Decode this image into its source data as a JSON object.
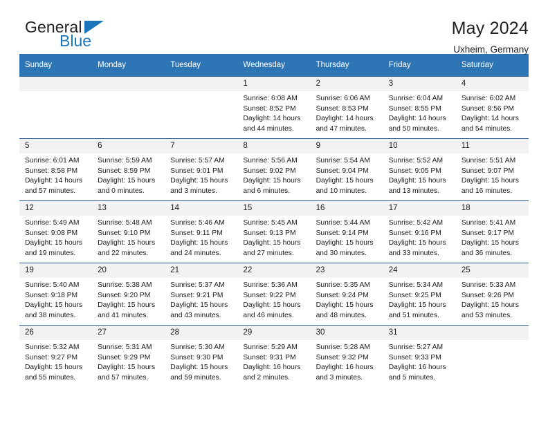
{
  "brand": {
    "name_top": "General",
    "name_bottom": "Blue",
    "triangle_color": "#1b75bb",
    "top_color": "#231f20"
  },
  "header": {
    "title": "May 2024",
    "subtitle": "Uxheim, Germany"
  },
  "theme": {
    "header_bg": "#2e75b6",
    "row_divider": "#2b5f93",
    "daynum_bg": "#f2f2f2",
    "page_bg": "#ffffff"
  },
  "weekdays": [
    "Sunday",
    "Monday",
    "Tuesday",
    "Wednesday",
    "Thursday",
    "Friday",
    "Saturday"
  ],
  "labels": {
    "sunrise": "Sunrise:",
    "sunset": "Sunset:",
    "daylight": "Daylight:"
  },
  "weeks": [
    [
      {
        "day": "",
        "empty": true
      },
      {
        "day": "",
        "empty": true
      },
      {
        "day": "",
        "empty": true
      },
      {
        "day": "1",
        "sunrise": "Sunrise: 6:08 AM",
        "sunset": "Sunset: 8:52 PM",
        "daylight": "Daylight: 14 hours and 44 minutes."
      },
      {
        "day": "2",
        "sunrise": "Sunrise: 6:06 AM",
        "sunset": "Sunset: 8:53 PM",
        "daylight": "Daylight: 14 hours and 47 minutes."
      },
      {
        "day": "3",
        "sunrise": "Sunrise: 6:04 AM",
        "sunset": "Sunset: 8:55 PM",
        "daylight": "Daylight: 14 hours and 50 minutes."
      },
      {
        "day": "4",
        "sunrise": "Sunrise: 6:02 AM",
        "sunset": "Sunset: 8:56 PM",
        "daylight": "Daylight: 14 hours and 54 minutes."
      }
    ],
    [
      {
        "day": "5",
        "sunrise": "Sunrise: 6:01 AM",
        "sunset": "Sunset: 8:58 PM",
        "daylight": "Daylight: 14 hours and 57 minutes."
      },
      {
        "day": "6",
        "sunrise": "Sunrise: 5:59 AM",
        "sunset": "Sunset: 8:59 PM",
        "daylight": "Daylight: 15 hours and 0 minutes."
      },
      {
        "day": "7",
        "sunrise": "Sunrise: 5:57 AM",
        "sunset": "Sunset: 9:01 PM",
        "daylight": "Daylight: 15 hours and 3 minutes."
      },
      {
        "day": "8",
        "sunrise": "Sunrise: 5:56 AM",
        "sunset": "Sunset: 9:02 PM",
        "daylight": "Daylight: 15 hours and 6 minutes."
      },
      {
        "day": "9",
        "sunrise": "Sunrise: 5:54 AM",
        "sunset": "Sunset: 9:04 PM",
        "daylight": "Daylight: 15 hours and 10 minutes."
      },
      {
        "day": "10",
        "sunrise": "Sunrise: 5:52 AM",
        "sunset": "Sunset: 9:05 PM",
        "daylight": "Daylight: 15 hours and 13 minutes."
      },
      {
        "day": "11",
        "sunrise": "Sunrise: 5:51 AM",
        "sunset": "Sunset: 9:07 PM",
        "daylight": "Daylight: 15 hours and 16 minutes."
      }
    ],
    [
      {
        "day": "12",
        "sunrise": "Sunrise: 5:49 AM",
        "sunset": "Sunset: 9:08 PM",
        "daylight": "Daylight: 15 hours and 19 minutes."
      },
      {
        "day": "13",
        "sunrise": "Sunrise: 5:48 AM",
        "sunset": "Sunset: 9:10 PM",
        "daylight": "Daylight: 15 hours and 22 minutes."
      },
      {
        "day": "14",
        "sunrise": "Sunrise: 5:46 AM",
        "sunset": "Sunset: 9:11 PM",
        "daylight": "Daylight: 15 hours and 24 minutes."
      },
      {
        "day": "15",
        "sunrise": "Sunrise: 5:45 AM",
        "sunset": "Sunset: 9:13 PM",
        "daylight": "Daylight: 15 hours and 27 minutes."
      },
      {
        "day": "16",
        "sunrise": "Sunrise: 5:44 AM",
        "sunset": "Sunset: 9:14 PM",
        "daylight": "Daylight: 15 hours and 30 minutes."
      },
      {
        "day": "17",
        "sunrise": "Sunrise: 5:42 AM",
        "sunset": "Sunset: 9:16 PM",
        "daylight": "Daylight: 15 hours and 33 minutes."
      },
      {
        "day": "18",
        "sunrise": "Sunrise: 5:41 AM",
        "sunset": "Sunset: 9:17 PM",
        "daylight": "Daylight: 15 hours and 36 minutes."
      }
    ],
    [
      {
        "day": "19",
        "sunrise": "Sunrise: 5:40 AM",
        "sunset": "Sunset: 9:18 PM",
        "daylight": "Daylight: 15 hours and 38 minutes."
      },
      {
        "day": "20",
        "sunrise": "Sunrise: 5:38 AM",
        "sunset": "Sunset: 9:20 PM",
        "daylight": "Daylight: 15 hours and 41 minutes."
      },
      {
        "day": "21",
        "sunrise": "Sunrise: 5:37 AM",
        "sunset": "Sunset: 9:21 PM",
        "daylight": "Daylight: 15 hours and 43 minutes."
      },
      {
        "day": "22",
        "sunrise": "Sunrise: 5:36 AM",
        "sunset": "Sunset: 9:22 PM",
        "daylight": "Daylight: 15 hours and 46 minutes."
      },
      {
        "day": "23",
        "sunrise": "Sunrise: 5:35 AM",
        "sunset": "Sunset: 9:24 PM",
        "daylight": "Daylight: 15 hours and 48 minutes."
      },
      {
        "day": "24",
        "sunrise": "Sunrise: 5:34 AM",
        "sunset": "Sunset: 9:25 PM",
        "daylight": "Daylight: 15 hours and 51 minutes."
      },
      {
        "day": "25",
        "sunrise": "Sunrise: 5:33 AM",
        "sunset": "Sunset: 9:26 PM",
        "daylight": "Daylight: 15 hours and 53 minutes."
      }
    ],
    [
      {
        "day": "26",
        "sunrise": "Sunrise: 5:32 AM",
        "sunset": "Sunset: 9:27 PM",
        "daylight": "Daylight: 15 hours and 55 minutes."
      },
      {
        "day": "27",
        "sunrise": "Sunrise: 5:31 AM",
        "sunset": "Sunset: 9:29 PM",
        "daylight": "Daylight: 15 hours and 57 minutes."
      },
      {
        "day": "28",
        "sunrise": "Sunrise: 5:30 AM",
        "sunset": "Sunset: 9:30 PM",
        "daylight": "Daylight: 15 hours and 59 minutes."
      },
      {
        "day": "29",
        "sunrise": "Sunrise: 5:29 AM",
        "sunset": "Sunset: 9:31 PM",
        "daylight": "Daylight: 16 hours and 2 minutes."
      },
      {
        "day": "30",
        "sunrise": "Sunrise: 5:28 AM",
        "sunset": "Sunset: 9:32 PM",
        "daylight": "Daylight: 16 hours and 3 minutes."
      },
      {
        "day": "31",
        "sunrise": "Sunrise: 5:27 AM",
        "sunset": "Sunset: 9:33 PM",
        "daylight": "Daylight: 16 hours and 5 minutes."
      },
      {
        "day": "",
        "empty": true
      }
    ]
  ]
}
